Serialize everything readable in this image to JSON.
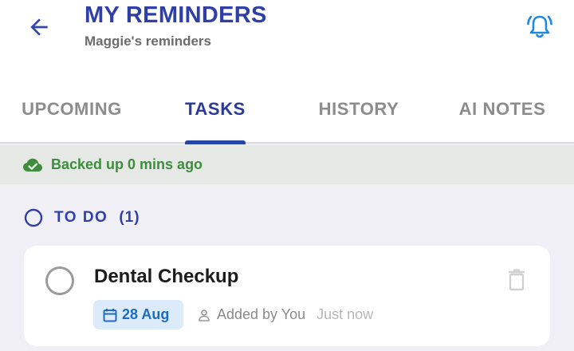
{
  "header": {
    "title": "MY REMINDERS",
    "subtitle": "Maggie's reminders",
    "back_icon": "arrow-left-icon",
    "bell_icon": "bell-ringing-icon"
  },
  "tabs": [
    {
      "label": "UPCOMING",
      "active": false
    },
    {
      "label": "TASKS",
      "active": true
    },
    {
      "label": "HISTORY",
      "active": false
    },
    {
      "label": "AI NOTES",
      "active": false
    }
  ],
  "backup": {
    "text": "Backed up 0 mins ago",
    "icon": "cloud-check-icon"
  },
  "section": {
    "label": "TO DO",
    "count": "(1)"
  },
  "tasks": [
    {
      "title": "Dental Checkup",
      "date": "28 Aug",
      "added_by": "Added by You",
      "time": "Just now",
      "completed": false
    }
  ],
  "colors": {
    "primary": "#2f3fa8",
    "accent_blue": "#1e88e5",
    "success_green": "#3d8d3d",
    "background": "#f0eff5",
    "date_chip_bg": "#dcebfa"
  }
}
